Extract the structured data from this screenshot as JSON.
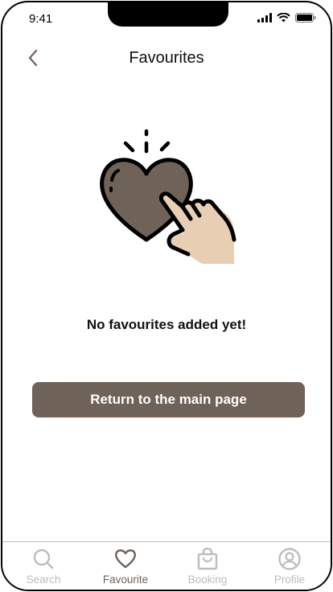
{
  "status_bar": {
    "time": "9:41"
  },
  "header": {
    "title": "Favourites"
  },
  "empty_state": {
    "message": "No favourites added yet!"
  },
  "actions": {
    "return_label": "Return to the main page"
  },
  "tabbar": {
    "active": "Favourite",
    "tabs": [
      {
        "label": "Search",
        "icon": "search-icon"
      },
      {
        "label": "Favourite",
        "icon": "heart-icon"
      },
      {
        "label": "Booking",
        "icon": "shopping-bag-icon"
      },
      {
        "label": "Profile",
        "icon": "user-circle-icon"
      }
    ]
  },
  "colors": {
    "accent": "#6f6259",
    "heart": "#6f6259",
    "hand": "#e8cfb4",
    "inactive": "#bdbdbd"
  }
}
